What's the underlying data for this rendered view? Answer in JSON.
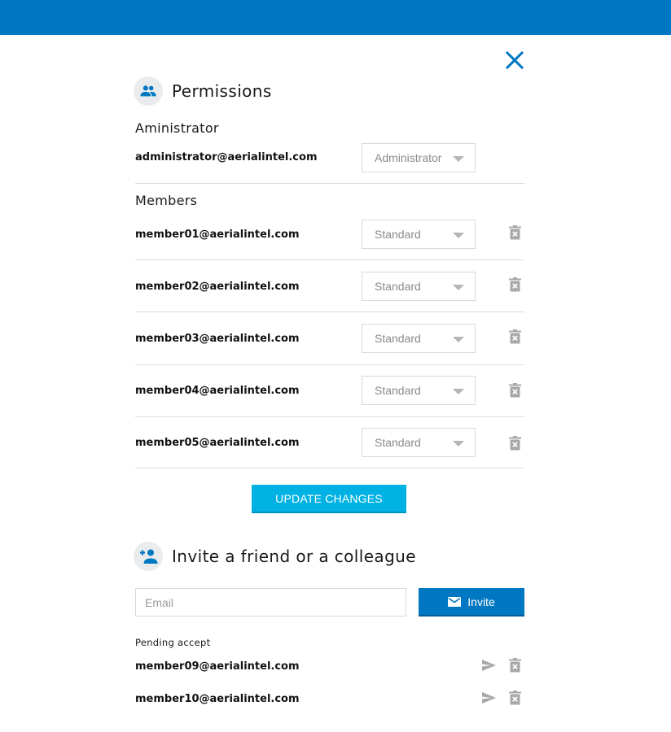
{
  "colors": {
    "brand": "#0077c2",
    "accent": "#00b2e3",
    "icon_gray": "#a8a8a8"
  },
  "icons": {
    "close": "close-icon",
    "permissions": "people-icon",
    "invite": "add-person-icon",
    "delete": "trash-icon",
    "resend": "send-icon",
    "mail": "mail-icon",
    "caret": "caret-down-icon"
  },
  "permissions": {
    "title": "Permissions",
    "administrator": {
      "heading": "Aministrator",
      "email": "administrator@aerialintel.com",
      "role": "Administrator"
    },
    "members": {
      "heading": "Members",
      "items": [
        {
          "email": "member01@aerialintel.com",
          "role": "Standard"
        },
        {
          "email": "member02@aerialintel.com",
          "role": "Standard"
        },
        {
          "email": "member03@aerialintel.com",
          "role": "Standard"
        },
        {
          "email": "member04@aerialintel.com",
          "role": "Standard"
        },
        {
          "email": "member05@aerialintel.com",
          "role": "Standard"
        }
      ]
    },
    "update_label": "UPDATE CHANGES"
  },
  "invite": {
    "title": "Invite a friend or a colleague",
    "email_placeholder": "Email",
    "button_label": "Invite",
    "pending": {
      "label": "Pending accept",
      "items": [
        {
          "email": "member09@aerialintel.com"
        },
        {
          "email": "member10@aerialintel.com"
        }
      ]
    }
  }
}
